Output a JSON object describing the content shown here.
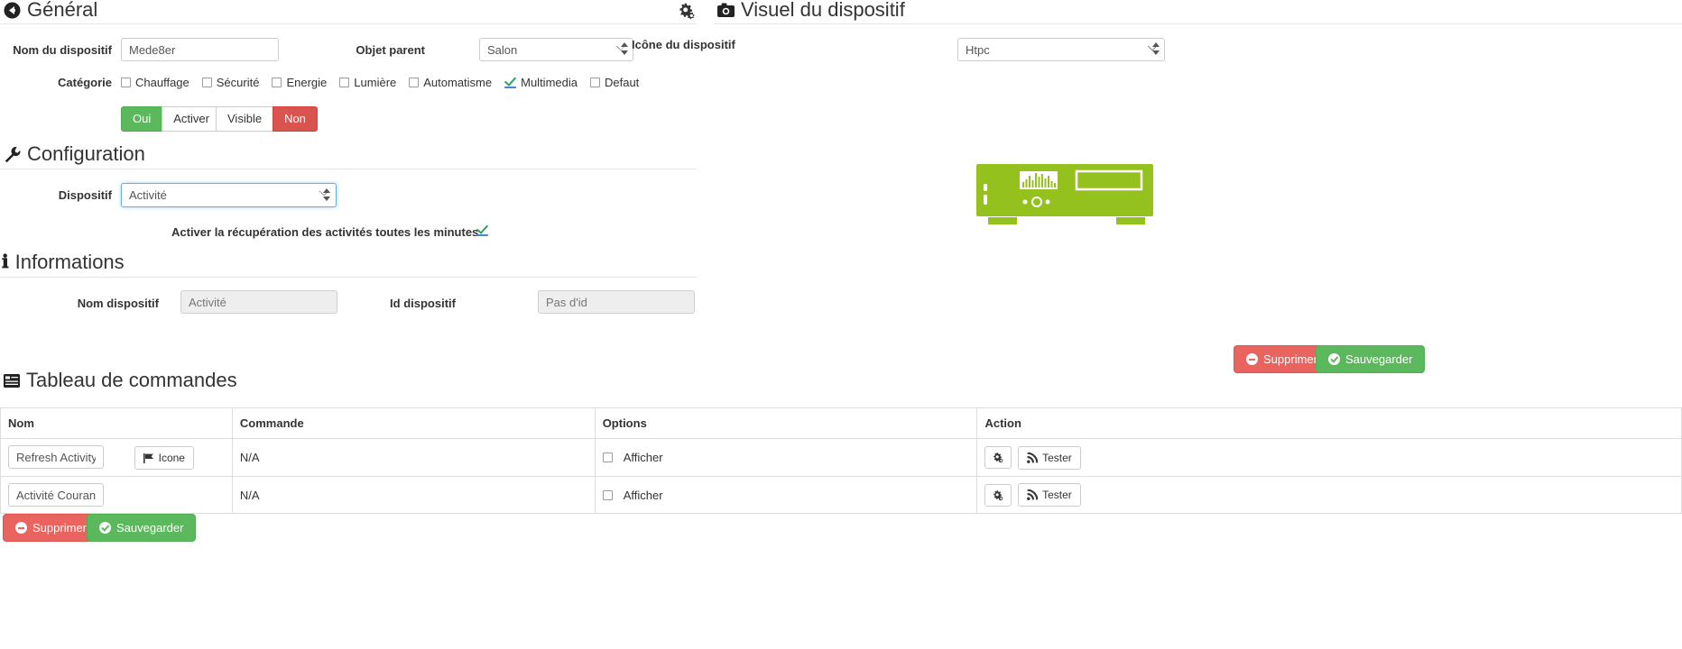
{
  "sections": {
    "general": {
      "title": "Général",
      "icon": "back-arrow-circle-icon"
    },
    "configuration": {
      "title": "Configuration",
      "icon": "wrench-icon"
    },
    "informations": {
      "title": "Informations",
      "icon": "info-icon"
    },
    "visual": {
      "title": "Visuel du dispositif",
      "icon": "camera-icon"
    },
    "commands": {
      "title": "Tableau de commandes",
      "icon": "table-icon"
    }
  },
  "toolbar": {
    "gear_icon": "gears-icon"
  },
  "general": {
    "name_label": "Nom du dispositif",
    "name_value": "Mede8er",
    "parent_label": "Objet parent",
    "parent_value": "Salon",
    "parent_options": [
      "Salon"
    ],
    "category_label": "Catégorie",
    "categories": [
      {
        "label": "Chauffage",
        "checked": false
      },
      {
        "label": "Sécurité",
        "checked": false
      },
      {
        "label": "Energie",
        "checked": false
      },
      {
        "label": "Lumière",
        "checked": false
      },
      {
        "label": "Automatisme",
        "checked": false
      },
      {
        "label": "Multimedia",
        "checked": true
      },
      {
        "label": "Defaut",
        "checked": false
      }
    ],
    "toggles": [
      {
        "label": "Oui",
        "state": "green"
      },
      {
        "label": "Activer",
        "state": "off"
      },
      {
        "label": "Visible",
        "state": "off"
      },
      {
        "label": "Non",
        "state": "red"
      }
    ]
  },
  "visual": {
    "icon_label": "Icône du dispositif",
    "icon_value": "Htpc",
    "icon_options": [
      "Htpc"
    ],
    "device_image": "htpc-media-center-icon",
    "device_color": "#95c11f"
  },
  "configuration": {
    "device_label": "Dispositif",
    "device_value": "Activité",
    "device_options": [
      "Activité"
    ],
    "refresh_label": "Activer la récupération des activités toutes les minutes",
    "refresh_checked": true
  },
  "informations": {
    "name_label": "Nom dispositif",
    "name_value": "Activité",
    "id_label": "Id dispositif",
    "id_value": "Pas d'id"
  },
  "actions": {
    "delete_label": "Supprimer",
    "save_label": "Sauvegarder",
    "delete_icon": "minus-circle-icon",
    "save_icon": "check-circle-icon"
  },
  "commands_table": {
    "headers": [
      "Nom",
      "Commande",
      "Options",
      "Action"
    ],
    "rows": [
      {
        "name": "Refresh Activity",
        "icon_button": "Icone",
        "icon_button_glyph": "flag-icon",
        "command": "N/A",
        "option_label": "Afficher",
        "option_checked": false,
        "config_icon": "gears-icon",
        "test_label": "Tester",
        "test_icon": "signal-icon"
      },
      {
        "name": "Activité Courante",
        "icon_button": null,
        "icon_button_glyph": null,
        "command": "N/A",
        "option_label": "Afficher",
        "option_checked": false,
        "config_icon": "gears-icon",
        "test_label": "Tester",
        "test_icon": "signal-icon"
      }
    ]
  },
  "colors": {
    "green": "#5cb85c",
    "red": "#d9534f",
    "danger_btn": "#e9635f",
    "device_green": "#95c11f",
    "focus_blue": "#66afe9"
  }
}
